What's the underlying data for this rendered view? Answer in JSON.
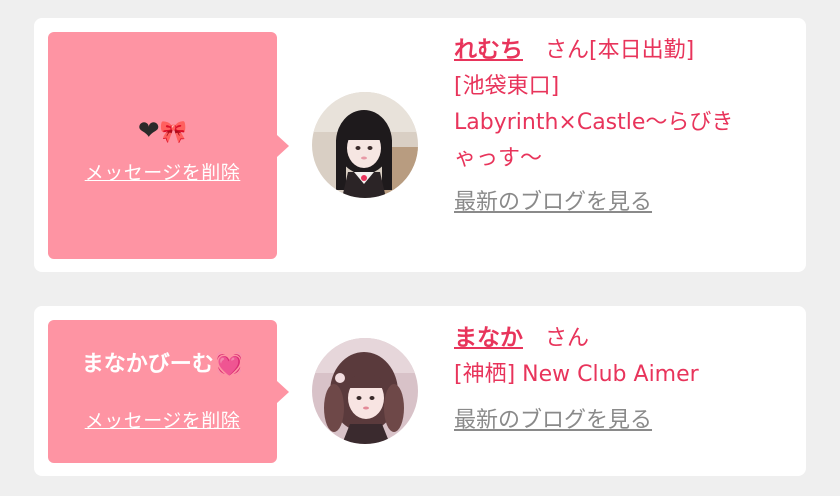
{
  "messages": [
    {
      "bubble_text": "",
      "bubble_emoji_1": "❤",
      "bubble_emoji_2": "🎀",
      "delete_label": "メッセージを削除",
      "name": "れむち",
      "honorific": "さん[本日出勤]",
      "shop": "[池袋東口] Labyrinth×Castle～らびきゃっす～",
      "blog_label": "最新のブログを見る",
      "avatar": "girl-black-hair-avatar"
    },
    {
      "bubble_text": "まなかびーむ",
      "bubble_emoji_2": "💓",
      "delete_label": "メッセージを削除",
      "name": "まなか",
      "honorific": "さん",
      "shop": "[神栖] New Club Aimer",
      "blog_label": "最新のブログを見る",
      "avatar": "girl-brown-hair-avatar"
    }
  ],
  "colors": {
    "bubble": "#fe94a3",
    "accent": "#e8345b",
    "muted_link": "#8a8a8a",
    "background": "#efefef"
  }
}
